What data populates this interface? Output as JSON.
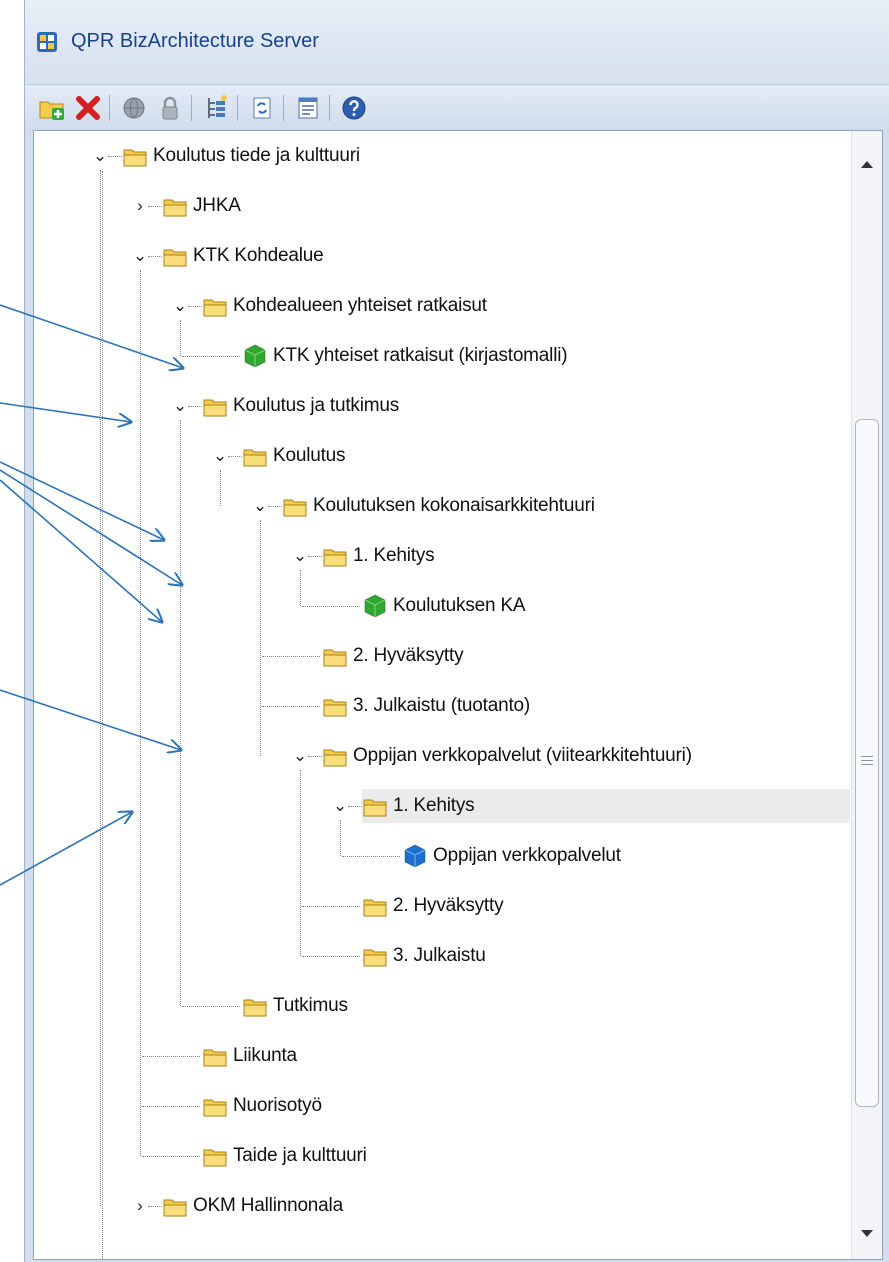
{
  "window": {
    "title": "QPR BizArchitecture Server"
  },
  "toolbar": {
    "buttons": [
      {
        "name": "new-folder-button",
        "icon": "folder-add-icon"
      },
      {
        "name": "delete-button",
        "icon": "delete-x-icon"
      },
      {
        "name": "publish-button",
        "icon": "globe-icon"
      },
      {
        "name": "lock-button",
        "icon": "lock-icon"
      },
      {
        "name": "tree-view-button",
        "icon": "tree-icon"
      },
      {
        "name": "refresh-button",
        "icon": "refresh-icon"
      },
      {
        "name": "properties-button",
        "icon": "properties-icon"
      },
      {
        "name": "help-button",
        "icon": "help-icon"
      }
    ]
  },
  "tree": {
    "nodes": [
      {
        "label": "Koulutus tiede ja kulttuuri",
        "depth": 0,
        "expander": "expanded",
        "icon": "folder-icon"
      },
      {
        "label": "JHKA",
        "depth": 1,
        "expander": "collapsed",
        "icon": "folder-icon"
      },
      {
        "label": "KTK Kohdealue",
        "depth": 1,
        "expander": "expanded",
        "icon": "folder-icon"
      },
      {
        "label": "Kohdealueen yhteiset ratkaisut",
        "depth": 2,
        "expander": "expanded",
        "icon": "folder-icon"
      },
      {
        "label": "KTK yhteiset ratkaisut (kirjastomalli)",
        "depth": 3,
        "expander": "none",
        "icon": "green-model-icon"
      },
      {
        "label": "Koulutus ja tutkimus",
        "depth": 2,
        "expander": "expanded",
        "icon": "folder-icon"
      },
      {
        "label": "Koulutus",
        "depth": 3,
        "expander": "expanded",
        "icon": "folder-icon"
      },
      {
        "label": "Koulutuksen kokonaisarkkitehtuuri",
        "depth": 4,
        "expander": "expanded",
        "icon": "folder-icon"
      },
      {
        "label": "1. Kehitys",
        "depth": 5,
        "expander": "expanded",
        "icon": "folder-icon"
      },
      {
        "label": "Koulutuksen KA",
        "depth": 6,
        "expander": "none",
        "icon": "green-model-icon"
      },
      {
        "label": "2. Hyväksytty",
        "depth": 5,
        "expander": "none",
        "icon": "folder-icon"
      },
      {
        "label": "3. Julkaistu (tuotanto)",
        "depth": 5,
        "expander": "none",
        "icon": "folder-icon"
      },
      {
        "label": "Oppijan verkkopalvelut (viitearkkitehtuuri)",
        "depth": 5,
        "expander": "expanded",
        "icon": "folder-icon"
      },
      {
        "label": "1. Kehitys",
        "depth": 6,
        "expander": "expanded",
        "icon": "folder-icon",
        "selected": true
      },
      {
        "label": "Oppijan verkkopalvelut",
        "depth": 7,
        "expander": "none",
        "icon": "blue-model-icon"
      },
      {
        "label": "2. Hyväksytty",
        "depth": 6,
        "expander": "none",
        "icon": "folder-icon"
      },
      {
        "label": "3. Julkaistu",
        "depth": 6,
        "expander": "none",
        "icon": "folder-icon"
      },
      {
        "label": "Tutkimus",
        "depth": 3,
        "expander": "none",
        "icon": "folder-icon"
      },
      {
        "label": "Liikunta",
        "depth": 2,
        "expander": "none",
        "icon": "folder-icon"
      },
      {
        "label": "Nuorisotyö",
        "depth": 2,
        "expander": "none",
        "icon": "folder-icon"
      },
      {
        "label": "Taide ja kulttuuri",
        "depth": 2,
        "expander": "none",
        "icon": "folder-icon"
      },
      {
        "label": "OKM Hallinnonala",
        "depth": 1,
        "expander": "collapsed",
        "icon": "folder-icon"
      }
    ]
  },
  "scrollbar": {
    "up_icon": "scroll-up-arrow-icon",
    "down_icon": "scroll-down-arrow-icon"
  },
  "annotations": {
    "arrow_color": "#2e74b5",
    "count": 7
  },
  "colors": {
    "folder": "#f2cc4a",
    "green_model": "#2fa82f",
    "blue_model": "#1a6fd0",
    "selection": "#ebebeb"
  }
}
